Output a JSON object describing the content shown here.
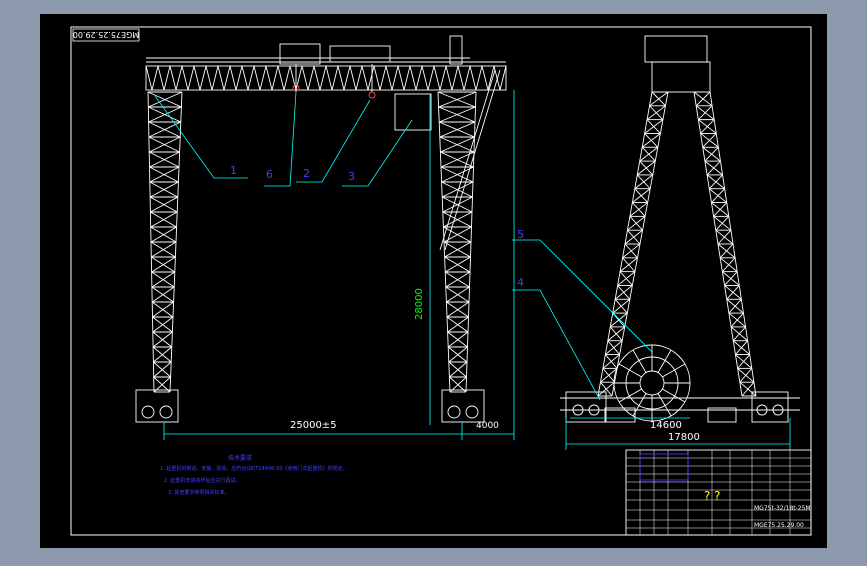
{
  "drawing": {
    "number_rotated": "MGE75.25.29.00",
    "title_name": "MG75t-32/18t-25M",
    "title_number": "MGE75.25.29.00",
    "title_marks": "? ?"
  },
  "callouts": {
    "front": [
      "1",
      "6",
      "2",
      "3"
    ],
    "side": [
      "5",
      "4"
    ]
  },
  "dimensions": {
    "height": "28000",
    "span": "25000±5",
    "leg_offset": "4000",
    "rail_gauge": "14600",
    "base_width": "17800"
  },
  "notes": {
    "heading": "技术要求",
    "lines": [
      "1. 起重机的制造、安装、验收，应符合GB/T14406-93《通用门式起重机》的规定。",
      "2. 起重机安装完毕后应进行调试。",
      "3. 其他要求参照相关标准。"
    ]
  },
  "colors": {
    "background": "#8d9aae",
    "canvas": "#000000",
    "structure": "#ffffff",
    "dimension": "#00ffff",
    "callout": "#4040ff",
    "dim_text_green": "#00ff00",
    "hook": "#ff4040"
  }
}
